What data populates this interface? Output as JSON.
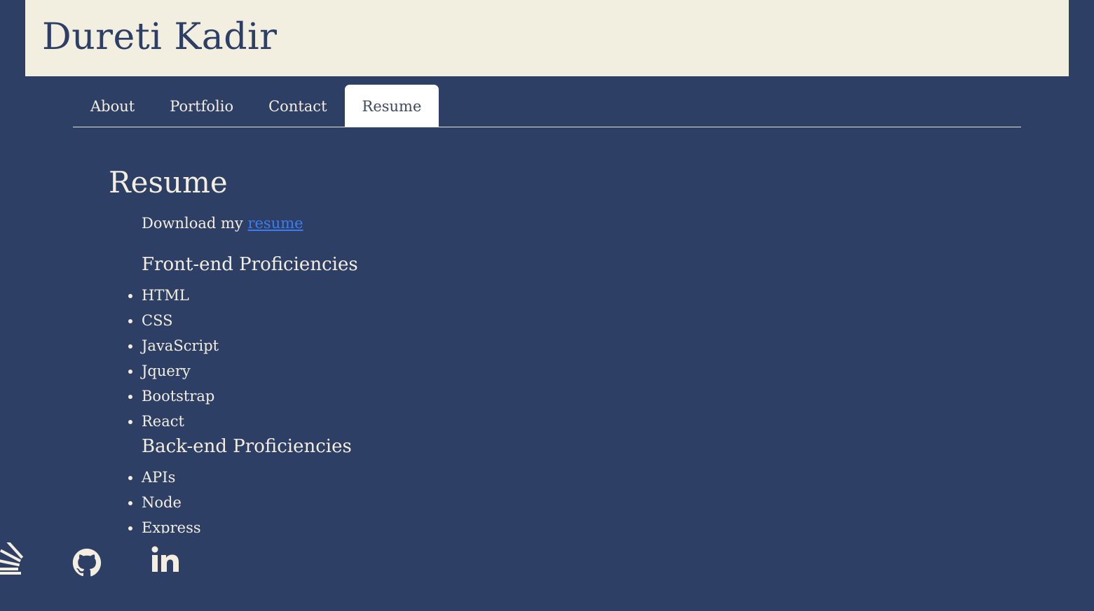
{
  "header": {
    "title": "Dureti Kadir"
  },
  "nav": {
    "tabs": [
      {
        "label": "About",
        "active": false
      },
      {
        "label": "Portfolio",
        "active": false
      },
      {
        "label": "Contact",
        "active": false
      },
      {
        "label": "Resume",
        "active": true
      }
    ]
  },
  "resume": {
    "title": "Resume",
    "download_prefix": "Download my",
    "download_link": "resume",
    "frontend": {
      "heading": "Front-end Proficiencies",
      "items": [
        "HTML",
        "CSS",
        "JavaScript",
        "Jquery",
        "Bootstrap",
        "React"
      ]
    },
    "backend": {
      "heading": "Back-end Proficiencies",
      "items": [
        "APIs",
        "Node",
        "Express"
      ]
    }
  },
  "social": {
    "icons": [
      "stackoverflow-icon",
      "github-icon",
      "linkedin-icon"
    ]
  },
  "colors": {
    "background": "#2e3f65",
    "header_bg": "#f3efe0",
    "text": "#f3eee0",
    "link": "#3c7cf0",
    "active_tab_bg": "#ffffff"
  }
}
